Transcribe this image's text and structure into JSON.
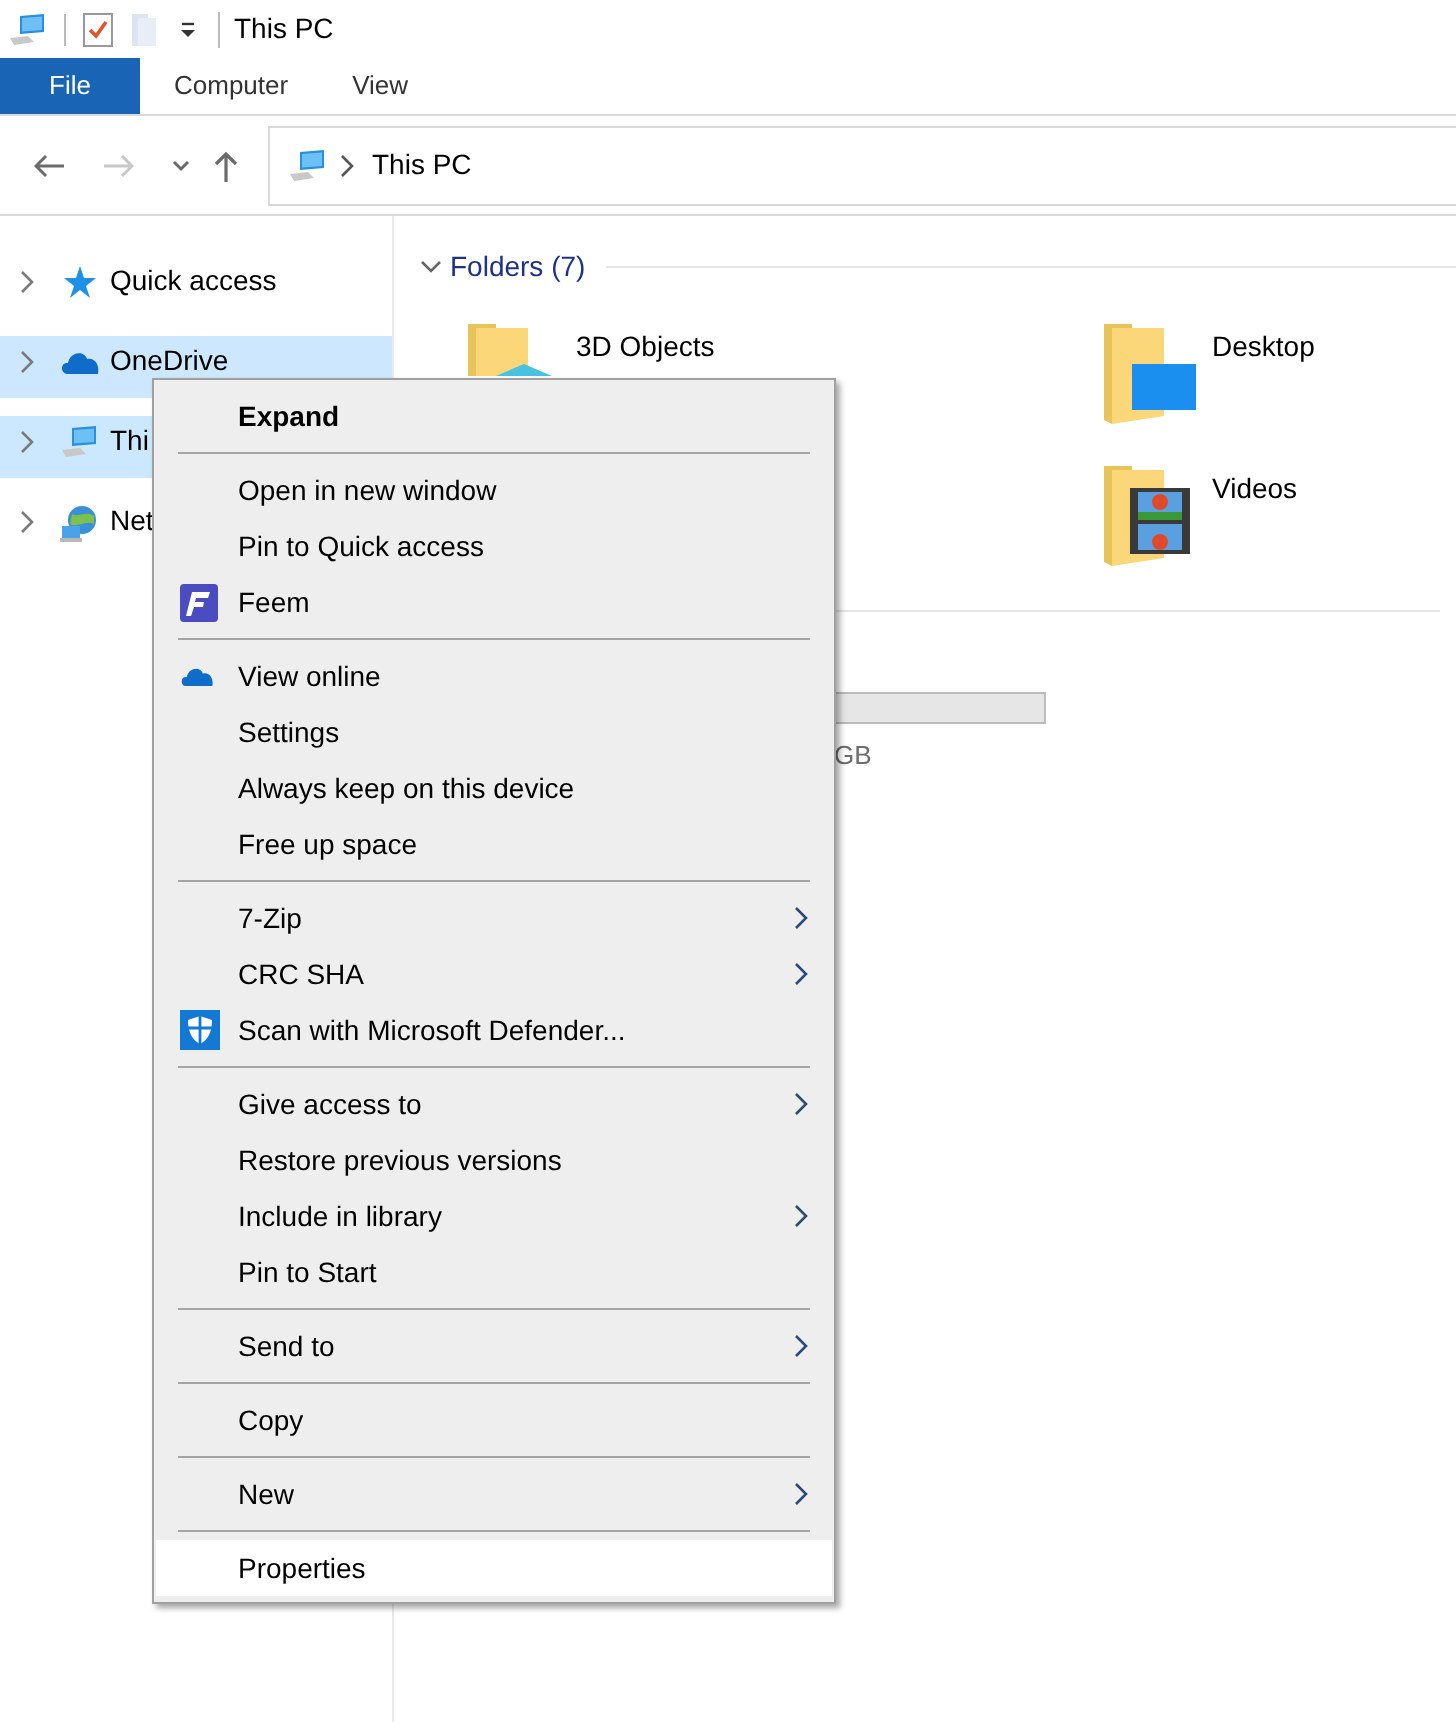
{
  "title_bar": {
    "title": "This PC"
  },
  "ribbon_tabs": [
    {
      "label": "File",
      "kind": "file"
    },
    {
      "label": "Computer",
      "kind": "tab"
    },
    {
      "label": "View",
      "kind": "tab"
    }
  ],
  "navigation": [
    {
      "kind": "back",
      "disabled": false
    },
    {
      "kind": "forward",
      "disabled": true
    },
    {
      "kind": "recent",
      "disabled": false
    },
    {
      "kind": "up",
      "disabled": false
    }
  ],
  "address_bar": {
    "path": "This PC"
  },
  "sidebar": {
    "items": [
      {
        "label": "Quick access",
        "selected": false,
        "hovered": false
      },
      {
        "label": "OneDrive",
        "selected": false,
        "hovered": true
      },
      {
        "label": "Thi",
        "selected": true,
        "hovered": false
      },
      {
        "label": "Net",
        "selected": false,
        "hovered": false
      }
    ]
  },
  "folders": {
    "header": "Folders (7)",
    "expanded": true,
    "items": [
      {
        "name": "3D Objects"
      },
      {
        "name": "Desktop"
      },
      {
        "name": "Videos"
      }
    ]
  },
  "drives": {
    "items": [
      {
        "size_text": "GB"
      }
    ]
  },
  "context_menu": {
    "items": [
      {
        "kind": "item",
        "label": "Expand",
        "default": true,
        "submenu": false,
        "selected": false
      },
      {
        "kind": "separator"
      },
      {
        "kind": "item",
        "label": "Open in new window",
        "default": false,
        "submenu": false,
        "selected": false
      },
      {
        "kind": "item",
        "label": "Pin to Quick access",
        "default": false,
        "submenu": false,
        "selected": false
      },
      {
        "kind": "item",
        "label": "Feem",
        "default": false,
        "submenu": false,
        "selected": false
      },
      {
        "kind": "separator"
      },
      {
        "kind": "item",
        "label": "View online",
        "default": false,
        "submenu": false,
        "selected": false
      },
      {
        "kind": "item",
        "label": "Settings",
        "default": false,
        "submenu": false,
        "selected": false
      },
      {
        "kind": "item",
        "label": "Always keep on this device",
        "default": false,
        "submenu": false,
        "selected": false
      },
      {
        "kind": "item",
        "label": "Free up space",
        "default": false,
        "submenu": false,
        "selected": false
      },
      {
        "kind": "separator"
      },
      {
        "kind": "item",
        "label": "7-Zip",
        "default": false,
        "submenu": true,
        "selected": false
      },
      {
        "kind": "item",
        "label": "CRC SHA",
        "default": false,
        "submenu": true,
        "selected": false
      },
      {
        "kind": "item",
        "label": "Scan with Microsoft Defender...",
        "default": false,
        "submenu": false,
        "selected": false
      },
      {
        "kind": "separator"
      },
      {
        "kind": "item",
        "label": "Give access to",
        "default": false,
        "submenu": true,
        "selected": false
      },
      {
        "kind": "item",
        "label": "Restore previous versions",
        "default": false,
        "submenu": false,
        "selected": false
      },
      {
        "kind": "item",
        "label": "Include in library",
        "default": false,
        "submenu": true,
        "selected": false
      },
      {
        "kind": "item",
        "label": "Pin to Start",
        "default": false,
        "submenu": false,
        "selected": false
      },
      {
        "kind": "separator"
      },
      {
        "kind": "item",
        "label": "Send to",
        "default": false,
        "submenu": true,
        "selected": false
      },
      {
        "kind": "separator"
      },
      {
        "kind": "item",
        "label": "Copy",
        "default": false,
        "submenu": false,
        "selected": false
      },
      {
        "kind": "separator"
      },
      {
        "kind": "item",
        "label": "New",
        "default": false,
        "submenu": true,
        "selected": false
      },
      {
        "kind": "separator"
      },
      {
        "kind": "item",
        "label": "Properties",
        "default": false,
        "submenu": false,
        "selected": true
      }
    ]
  }
}
